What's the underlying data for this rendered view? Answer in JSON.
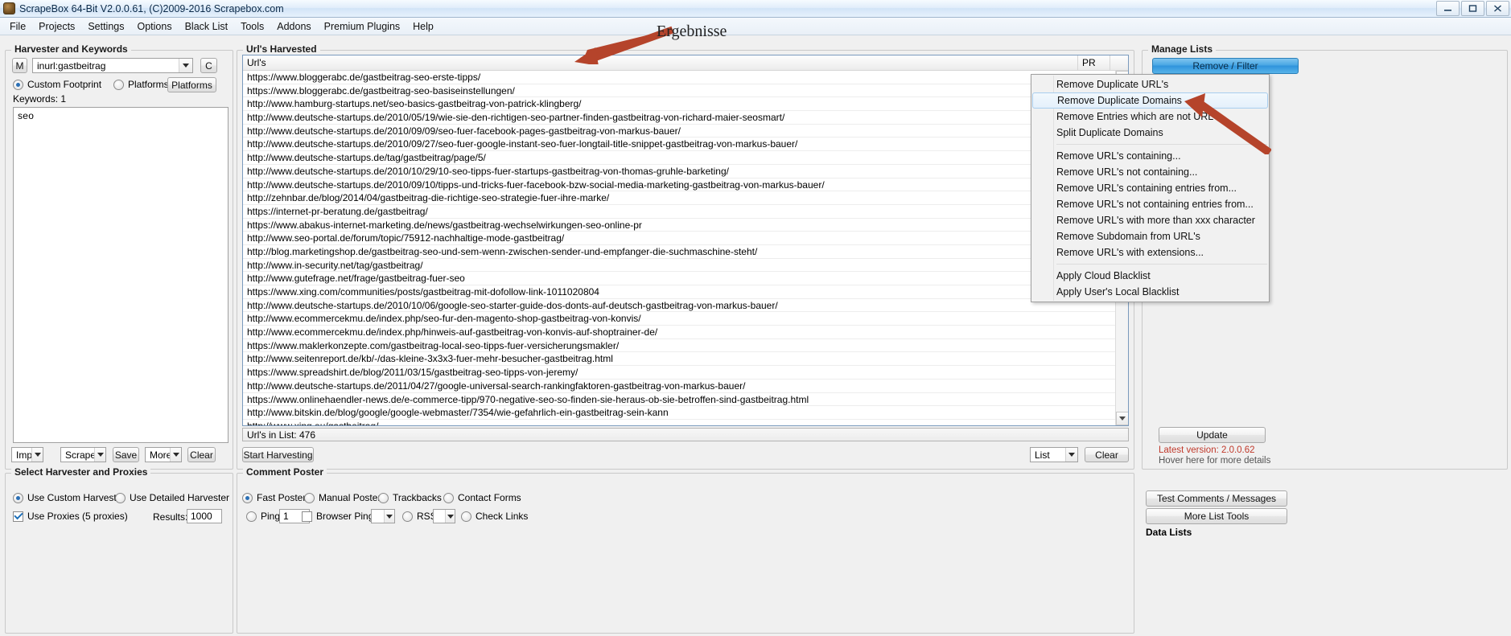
{
  "window": {
    "title": "ScrapeBox 64-Bit V2.0.0.61, (C)2009-2016 Scrapebox.com",
    "minimize": "–",
    "maximize": "□",
    "close": "✕"
  },
  "menubar": [
    "File",
    "Projects",
    "Settings",
    "Options",
    "Black List",
    "Tools",
    "Addons",
    "Premium Plugins",
    "Help"
  ],
  "annotation": {
    "label": "Ergebnisse"
  },
  "harvester": {
    "group_label": "Harvester and Keywords",
    "mode_button": "M",
    "footprint_value": "inurl:gastbeitrag",
    "c_button": "C",
    "radio_custom": "Custom Footprint",
    "radio_platforms": "Platforms",
    "platforms_button": "Platforms",
    "keywords_label": "Keywords:  1",
    "keywords": [
      "seo"
    ],
    "buttons": [
      "Import",
      "Scrape",
      "Save",
      "More",
      "Clear"
    ]
  },
  "urls_harvested": {
    "group_label": "Url's Harvested",
    "col_url": "Url's",
    "col_pr": "PR",
    "status": "Url's in List: 476",
    "start_button": "Start Harvesting",
    "list_button": "List",
    "clear_button": "Clear",
    "rows": [
      "https://www.bloggerabc.de/gastbeitrag-seo-erste-tipps/",
      "https://www.bloggerabc.de/gastbeitrag-seo-basiseinstellungen/",
      "http://www.hamburg-startups.net/seo-basics-gastbeitrag-von-patrick-klingberg/",
      "http://www.deutsche-startups.de/2010/05/19/wie-sie-den-richtigen-seo-partner-finden-gastbeitrag-von-richard-maier-seosmart/",
      "http://www.deutsche-startups.de/2010/09/09/seo-fuer-facebook-pages-gastbeitrag-von-markus-bauer/",
      "http://www.deutsche-startups.de/2010/09/27/seo-fuer-google-instant-seo-fuer-longtail-title-snippet-gastbeitrag-von-markus-bauer/",
      "http://www.deutsche-startups.de/tag/gastbeitrag/page/5/",
      "http://www.deutsche-startups.de/2010/10/29/10-seo-tipps-fuer-startups-gastbeitrag-von-thomas-gruhle-barketing/",
      "http://www.deutsche-startups.de/2010/09/10/tipps-und-tricks-fuer-facebook-bzw-social-media-marketing-gastbeitrag-von-markus-bauer/",
      "http://zehnbar.de/blog/2014/04/gastbeitrag-die-richtige-seo-strategie-fuer-ihre-marke/",
      "https://internet-pr-beratung.de/gastbeitrag/",
      "https://www.abakus-internet-marketing.de/news/gastbeitrag-wechselwirkungen-seo-online-pr",
      "http://www.seo-portal.de/forum/topic/75912-nachhaltige-mode-gastbeitrag/",
      "http://blog.marketingshop.de/gastbeitrag-seo-und-sem-wenn-zwischen-sender-und-empfanger-die-suchmaschine-steht/",
      "http://www.in-security.net/tag/gastbeitrag/",
      "http://www.gutefrage.net/frage/gastbeitrag-fuer-seo",
      "https://www.xing.com/communities/posts/gastbeitrag-mit-dofollow-link-1011020804",
      "http://www.deutsche-startups.de/2010/10/06/google-seo-starter-guide-dos-donts-auf-deutsch-gastbeitrag-von-markus-bauer/",
      "http://www.ecommercekmu.de/index.php/seo-fur-den-magento-shop-gastbeitrag-von-konvis/",
      "http://www.ecommercekmu.de/index.php/hinweis-auf-gastbeitrag-von-konvis-auf-shoptrainer-de/",
      "https://www.maklerkonzepte.com/gastbeitrag-local-seo-tipps-fuer-versicherungsmakler/",
      "http://www.seitenreport.de/kb/-/das-kleine-3x3x3-fuer-mehr-besucher-gastbeitrag.html",
      "https://www.spreadshirt.de/blog/2011/03/15/gastbeitrag-seo-tipps-von-jeremy/",
      "http://www.deutsche-startups.de/2011/04/27/google-universal-search-rankingfaktoren-gastbeitrag-von-markus-bauer/",
      "https://www.onlinehaendler-news.de/e-commerce-tipp/970-negative-seo-so-finden-sie-heraus-ob-sie-betroffen-sind-gastbeitrag.html",
      "http://www.bitskin.de/blog/google/google-webmaster/7354/wie-gefahrlich-ein-gastbeitrag-sein-kann",
      "http://www.xing.eu/gastbeitrag/"
    ]
  },
  "context_menu": {
    "items": [
      {
        "label": "Remove Duplicate URL's",
        "selected": false,
        "sep_after": false
      },
      {
        "label": "Remove Duplicate Domains",
        "selected": true,
        "sep_after": false
      },
      {
        "label": "Remove Entries which are not URL's",
        "selected": false,
        "sep_after": false
      },
      {
        "label": "Split Duplicate Domains",
        "selected": false,
        "sep_after": true
      },
      {
        "label": "Remove URL's containing...",
        "selected": false,
        "sep_after": false
      },
      {
        "label": "Remove URL's not containing...",
        "selected": false,
        "sep_after": false
      },
      {
        "label": "Remove URL's containing entries from...",
        "selected": false,
        "sep_after": false
      },
      {
        "label": "Remove URL's not containing entries from...",
        "selected": false,
        "sep_after": false
      },
      {
        "label": "Remove URL's with more than xxx character",
        "selected": false,
        "sep_after": false
      },
      {
        "label": "Remove Subdomain from URL's",
        "selected": false,
        "sep_after": false
      },
      {
        "label": "Remove URL's with extensions...",
        "selected": false,
        "sep_after": true
      },
      {
        "label": "Apply Cloud Blacklist",
        "selected": false,
        "sep_after": false
      },
      {
        "label": "Apply User's Local Blacklist",
        "selected": false,
        "sep_after": false
      }
    ]
  },
  "manage_lists": {
    "group_label": "Manage Lists",
    "remove_filter": "Remove / Filter",
    "update": "Update",
    "version_line": "Latest version:  2.0.0.62",
    "hover_line": "Hover here for more details"
  },
  "proxies": {
    "group_label": "Select Harvester and Proxies",
    "radio_custom_harvester": "Use Custom Harvester",
    "radio_detailed_harvester": "Use Detailed Harvester",
    "check_use_proxies": "Use Proxies (5 proxies)",
    "results_label": "Results:",
    "results_value": "1000"
  },
  "comment_poster": {
    "group_label": "Comment Poster",
    "radio_fast": "Fast Poster",
    "radio_manual": "Manual Poster",
    "radio_trackbacks": "Trackbacks",
    "radio_contact": "Contact Forms",
    "radio_ping": "Ping",
    "ping_value": "1",
    "check_browser_ping": "Browser Ping",
    "radio_rss": "RSS",
    "radio_check_links": "Check Links"
  },
  "tools": {
    "test_comments": "Test Comments / Messages",
    "more_list_tools": "More List Tools",
    "data_lists": "Data Lists"
  },
  "colors": {
    "accent_blue": "#2f94dc",
    "arrow_red": "#b5442b",
    "version_red": "#c0392b"
  }
}
